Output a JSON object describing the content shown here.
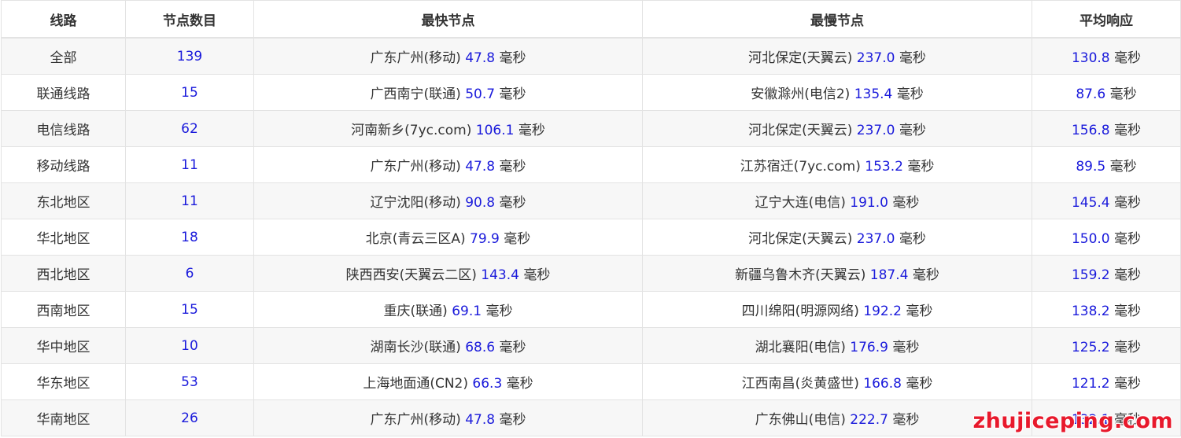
{
  "table": {
    "headers": [
      "线路",
      "节点数目",
      "最快节点",
      "最慢节点",
      "平均响应"
    ],
    "unit": "毫秒",
    "rows": [
      {
        "line": "全部",
        "count": "139",
        "fast_node": "广东广州(移动)",
        "fast_ms": "47.8",
        "slow_node": "河北保定(天翼云)",
        "slow_ms": "237.0",
        "avg_ms": "130.8"
      },
      {
        "line": "联通线路",
        "count": "15",
        "fast_node": "广西南宁(联通)",
        "fast_ms": "50.7",
        "slow_node": "安徽滁州(电信2)",
        "slow_ms": "135.4",
        "avg_ms": "87.6"
      },
      {
        "line": "电信线路",
        "count": "62",
        "fast_node": "河南新乡(7yc.com)",
        "fast_ms": "106.1",
        "slow_node": "河北保定(天翼云)",
        "slow_ms": "237.0",
        "avg_ms": "156.8"
      },
      {
        "line": "移动线路",
        "count": "11",
        "fast_node": "广东广州(移动)",
        "fast_ms": "47.8",
        "slow_node": "江苏宿迁(7yc.com)",
        "slow_ms": "153.2",
        "avg_ms": "89.5"
      },
      {
        "line": "东北地区",
        "count": "11",
        "fast_node": "辽宁沈阳(移动)",
        "fast_ms": "90.8",
        "slow_node": "辽宁大连(电信)",
        "slow_ms": "191.0",
        "avg_ms": "145.4"
      },
      {
        "line": "华北地区",
        "count": "18",
        "fast_node": "北京(青云三区A)",
        "fast_ms": "79.9",
        "slow_node": "河北保定(天翼云)",
        "slow_ms": "237.0",
        "avg_ms": "150.0"
      },
      {
        "line": "西北地区",
        "count": "6",
        "fast_node": "陕西西安(天翼云二区)",
        "fast_ms": "143.4",
        "slow_node": "新疆乌鲁木齐(天翼云)",
        "slow_ms": "187.4",
        "avg_ms": "159.2"
      },
      {
        "line": "西南地区",
        "count": "15",
        "fast_node": "重庆(联通)",
        "fast_ms": "69.1",
        "slow_node": "四川绵阳(明源网络)",
        "slow_ms": "192.2",
        "avg_ms": "138.2"
      },
      {
        "line": "华中地区",
        "count": "10",
        "fast_node": "湖南长沙(联通)",
        "fast_ms": "68.6",
        "slow_node": "湖北襄阳(电信)",
        "slow_ms": "176.9",
        "avg_ms": "125.2"
      },
      {
        "line": "华东地区",
        "count": "53",
        "fast_node": "上海地面通(CN2)",
        "fast_ms": "66.3",
        "slow_node": "江西南昌(炎黄盛世)",
        "slow_ms": "166.8",
        "avg_ms": "121.2"
      },
      {
        "line": "华南地区",
        "count": "26",
        "fast_node": "广东广州(移动)",
        "fast_ms": "47.8",
        "slow_node": "广东佛山(电信)",
        "slow_ms": "222.7",
        "avg_ms": "132.1"
      }
    ]
  },
  "watermark": "zhujiceping.com",
  "colors": {
    "number": "#1a1adb",
    "text": "#333333",
    "row_stripe": "#f7f7f7",
    "border": "#e3e3e3",
    "watermark": "#e8192c"
  }
}
